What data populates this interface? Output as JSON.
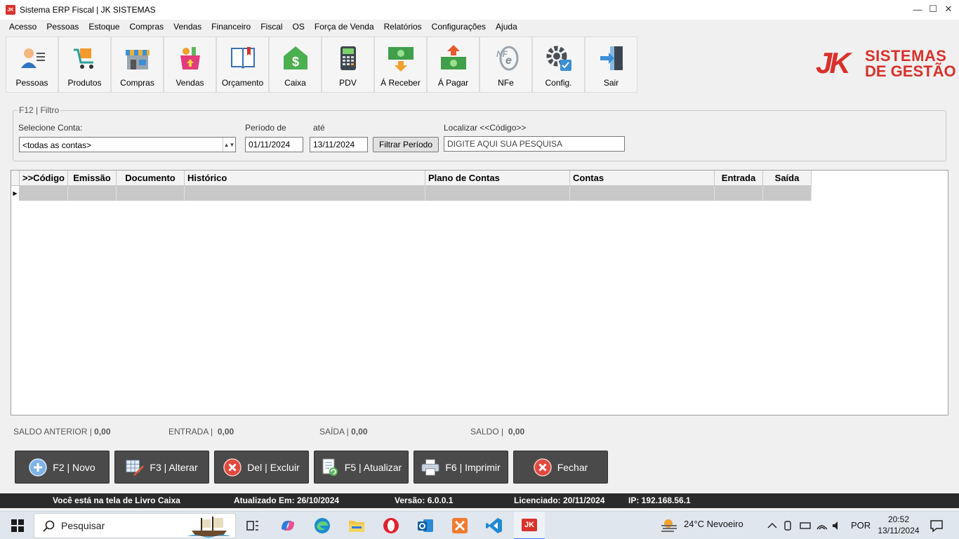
{
  "window": {
    "title": "Sistema ERP Fiscal | JK SISTEMAS",
    "app_icon": "JK",
    "minimize": "—",
    "maximize": "☐",
    "close": "✕"
  },
  "menu": [
    "Acesso",
    "Pessoas",
    "Estoque",
    "Compras",
    "Vendas",
    "Financeiro",
    "Fiscal",
    "OS",
    "Força de Venda",
    "Relatórios",
    "Configurações",
    "Ajuda"
  ],
  "toolbar": [
    {
      "label": "Pessoas",
      "icon": "person-icon"
    },
    {
      "label": "Produtos",
      "icon": "cart-icon"
    },
    {
      "label": "Compras",
      "icon": "store-icon"
    },
    {
      "label": "Vendas",
      "icon": "basket-icon"
    },
    {
      "label": "Orçamento",
      "icon": "book-icon"
    },
    {
      "label": "Caixa",
      "icon": "money-house-icon"
    },
    {
      "label": "PDV",
      "icon": "pos-terminal-icon"
    },
    {
      "label": "Á Receber",
      "icon": "receive-money-icon"
    },
    {
      "label": "Á Pagar",
      "icon": "pay-money-icon"
    },
    {
      "label": "NFe",
      "icon": "nfe-icon"
    },
    {
      "label": "Config.",
      "icon": "gear-icon"
    },
    {
      "label": "Sair",
      "icon": "exit-icon"
    }
  ],
  "logo": {
    "mark": "JK",
    "line1": "SISTEMAS",
    "line2": "DE GESTÃO"
  },
  "filter": {
    "legend": "F12 | Filtro",
    "account_label": "Selecione Conta:",
    "account_value": "<todas as contas>",
    "period_label": "Período de",
    "until_label": "até",
    "date_from": "01/11/2024",
    "date_to": "13/11/2024",
    "filter_button": "Filtrar Período",
    "search_label": "Localizar <<Código>>",
    "search_value": "DIGITE AQUI SUA PESQUISA"
  },
  "grid": {
    "columns": [
      ">>Código",
      "Emissão",
      "Documento",
      "Histórico",
      "Plano de Contas",
      "Contas",
      "Entrada",
      "Saída"
    ],
    "row_marker": "▶"
  },
  "totals": {
    "saldo_anterior_label": "SALDO ANTERIOR |",
    "saldo_anterior_value": "0,00",
    "entrada_label": "ENTRADA |",
    "entrada_value": "0,00",
    "saida_label": "SAÍDA |",
    "saida_value": "0,00",
    "saldo_label": "SALDO |",
    "saldo_value": "0,00"
  },
  "actions": [
    {
      "label": "F2 | Novo",
      "icon": "plus-icon"
    },
    {
      "label": "F3 | Alterar",
      "icon": "edit-icon"
    },
    {
      "label": "Del | Excluir",
      "icon": "delete-icon"
    },
    {
      "label": "F5 | Atualizar",
      "icon": "refresh-icon"
    },
    {
      "label": "F6 | Imprimir",
      "icon": "printer-icon"
    },
    {
      "label": "Fechar",
      "icon": "close-icon"
    }
  ],
  "status": {
    "screen": "Você está na tela de Livro Caixa",
    "updated": "Atualizado Em: 26/10/2024",
    "version": "Versão: 6.0.0.1",
    "licensed": "Licenciado: 20/11/2024",
    "ip": "IP: 192.168.56.1"
  },
  "taskbar": {
    "search_placeholder": "Pesquisar",
    "weather": "24°C  Nevoeiro",
    "language": "POR",
    "time": "20:52",
    "date": "13/11/2024",
    "jk_app": "JK"
  },
  "colors": {
    "brand": "#d9312b",
    "button_dark": "#4a4a4a",
    "status_bar": "#2b2b2b"
  }
}
